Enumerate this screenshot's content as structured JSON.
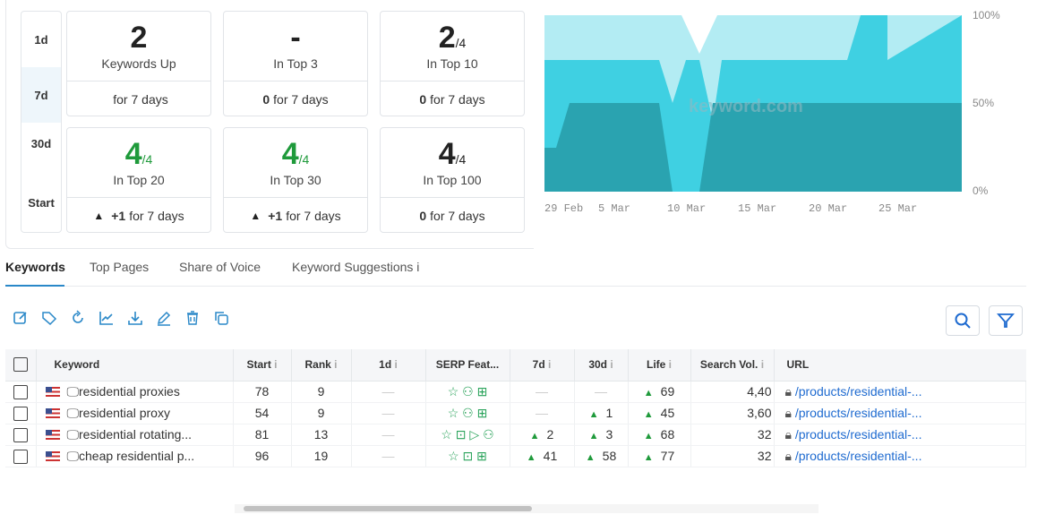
{
  "periods": [
    "1d",
    "7d",
    "30d",
    "Start"
  ],
  "active_period": "7d",
  "cards": [
    {
      "big": "2",
      "sub": "",
      "label": "Keywords Up",
      "foot_bold": "",
      "foot_text": "for 7 days",
      "arrow": false,
      "green": false
    },
    {
      "big": "-",
      "sub": "",
      "label": "In Top 3",
      "foot_bold": "0",
      "foot_text": "for 7 days",
      "arrow": false,
      "green": false
    },
    {
      "big": "2",
      "sub": "/4",
      "label": "In Top 10",
      "foot_bold": "0",
      "foot_text": "for 7 days",
      "arrow": false,
      "green": false
    },
    {
      "big": "4",
      "sub": "/4",
      "label": "In Top 20",
      "foot_bold": "+1",
      "foot_text": "for 7 days",
      "arrow": true,
      "green": true
    },
    {
      "big": "4",
      "sub": "/4",
      "label": "In Top 30",
      "foot_bold": "+1",
      "foot_text": "for 7 days",
      "arrow": true,
      "green": true
    },
    {
      "big": "4",
      "sub": "/4",
      "label": "In Top 100",
      "foot_bold": "0",
      "foot_text": "for 7 days",
      "arrow": false,
      "green": false
    }
  ],
  "chart": {
    "watermark": "keyword.com",
    "y_ticks": [
      "100%",
      "50%",
      "0%"
    ],
    "x_ticks": [
      "29 Feb",
      "5 Mar",
      "10 Mar",
      "15 Mar",
      "20 Mar",
      "25 Mar"
    ],
    "colors": {
      "top3": "#b3ecf3",
      "top10": "#3fd0e2",
      "top20": "#2aa3b0"
    }
  },
  "tabs": [
    "Keywords",
    "Top Pages",
    "Share of Voice",
    "Keyword Suggestions i"
  ],
  "active_tab": "Keywords",
  "toolbar_icons": [
    "edit-icon",
    "tag-icon",
    "refresh-icon",
    "chart-icon",
    "download-icon",
    "pencil-icon",
    "trash-icon",
    "copy-icon"
  ],
  "columns": [
    "Keyword",
    "Start",
    "Rank",
    "1d",
    "SERP Feat...",
    "7d",
    "30d",
    "Life",
    "Search Vol.",
    "URL"
  ],
  "info_mark": "i",
  "rows": [
    {
      "keyword": "residential proxies",
      "start": "78",
      "rank": "9",
      "d1": "—",
      "serp": "☆ ⚇ ⊞",
      "d7": "—",
      "d30": "—",
      "life": "69",
      "vol": "4,40",
      "url": "/products/residential-...",
      "d7_up": false,
      "d30_up": false
    },
    {
      "keyword": "residential proxy",
      "start": "54",
      "rank": "9",
      "d1": "—",
      "serp": "☆ ⚇ ⊞",
      "d7": "—",
      "d30": "1",
      "life": "45",
      "vol": "3,60",
      "url": "/products/residential-...",
      "d7_up": false,
      "d30_up": true
    },
    {
      "keyword": "residential rotating...",
      "start": "81",
      "rank": "13",
      "d1": "—",
      "serp": "☆ ⊡ ▷ ⚇",
      "d7": "2",
      "d30": "3",
      "life": "68",
      "vol": "32",
      "url": "/products/residential-...",
      "d7_up": true,
      "d30_up": true
    },
    {
      "keyword": "cheap residential p...",
      "start": "96",
      "rank": "19",
      "d1": "—",
      "serp": "☆ ⊡ ⊞",
      "d7": "41",
      "d30": "58",
      "life": "77",
      "vol": "32",
      "url": "/products/residential-...",
      "d7_up": true,
      "d30_up": true
    }
  ],
  "accent": "#2a88c8"
}
